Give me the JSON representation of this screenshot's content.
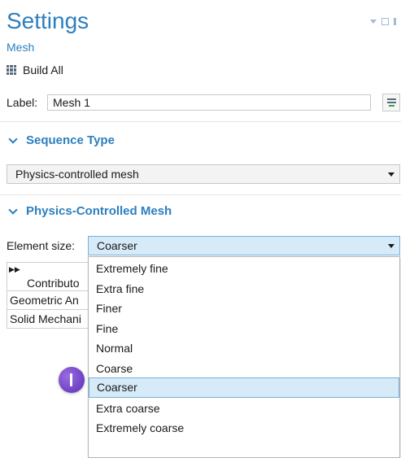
{
  "header": {
    "title": "Settings",
    "subtitle": "Mesh",
    "build_all": "Build All"
  },
  "label_row": {
    "label": "Label:",
    "value": "Mesh 1"
  },
  "sequence_section": {
    "title": "Sequence Type",
    "selected": "Physics-controlled mesh"
  },
  "physics_section": {
    "title": "Physics-Controlled Mesh",
    "element_size_label": "Element size:",
    "element_size_value": "Coarser",
    "options": [
      "Extremely fine",
      "Extra fine",
      "Finer",
      "Fine",
      "Normal",
      "Coarse",
      "Coarser",
      "Extra coarse",
      "Extremely coarse"
    ],
    "selected_option": "Coarser"
  },
  "table": {
    "header": "Contributo",
    "rows": [
      "Geometric An",
      "Solid Mechani"
    ]
  },
  "icons": {
    "build": "grid-icon",
    "label_button": "list-edit-icon",
    "window": [
      "dropdown-icon",
      "maximize-icon",
      "pin-icon"
    ],
    "cursor": "cursor-marker-icon"
  },
  "colors": {
    "accent": "#2c7fbe",
    "selection": "#d6eaf8",
    "marker": "#6a3fc8"
  }
}
